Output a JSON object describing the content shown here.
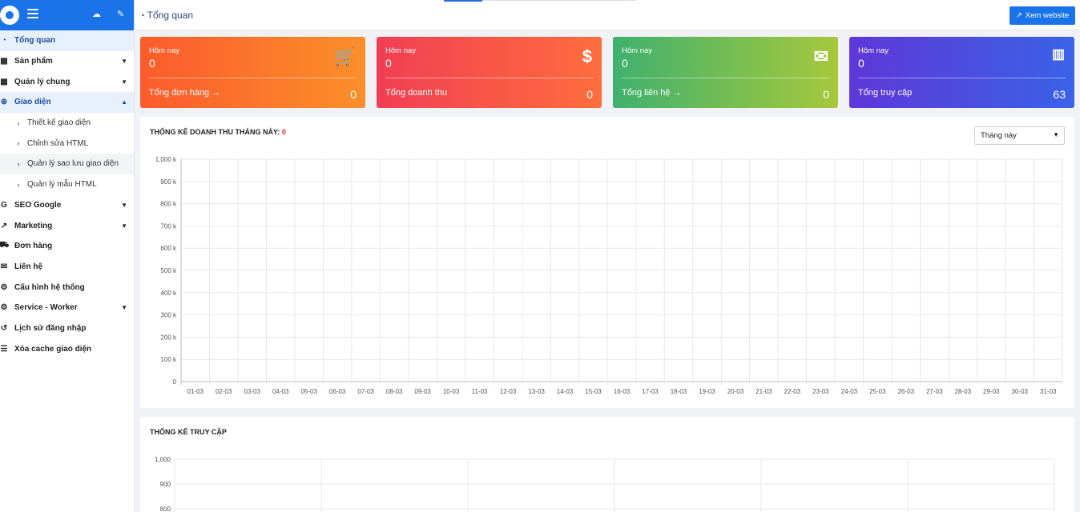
{
  "header": {
    "title": "Tổng quan",
    "view_site_label": "Xem website"
  },
  "sidebar": {
    "items": [
      {
        "label": "Tổng quan",
        "icon": "dashboard-icon"
      },
      {
        "label": "Sản phẩm",
        "icon": "grid-icon"
      },
      {
        "label": "Quản lý chung",
        "icon": "grid-icon"
      },
      {
        "label": "Giao diện",
        "icon": "globe-icon"
      },
      {
        "label": "Thiết kế giao diện"
      },
      {
        "label": "Chỉnh sửa HTML"
      },
      {
        "label": "Quản lý sao lưu giao diện"
      },
      {
        "label": "Quản lý mẫu HTML"
      },
      {
        "label": "SEO Google",
        "icon": "google-icon"
      },
      {
        "label": "Marketing",
        "icon": "chart-icon"
      },
      {
        "label": "Đơn hàng",
        "icon": "cart-icon"
      },
      {
        "label": "Liên hệ",
        "icon": "envelope-icon"
      },
      {
        "label": "Cấu hình hệ thống",
        "icon": "gear-icon"
      },
      {
        "label": "Service - Worker",
        "icon": "gears-icon"
      },
      {
        "label": "Lịch sử đăng nhập",
        "icon": "history-icon"
      },
      {
        "label": "Xóa cache giao diện",
        "icon": "database-icon"
      }
    ]
  },
  "cards": [
    {
      "top_label": "Hôm nay",
      "top_value": "0",
      "bottom_label": "Tổng đơn hàng →",
      "bottom_value": "0",
      "icon": "cart-icon"
    },
    {
      "top_label": "Hôm nay",
      "top_value": "0",
      "bottom_label": "Tổng doanh thu",
      "bottom_value": "0",
      "icon": "dollar-icon"
    },
    {
      "top_label": "Hôm nay",
      "top_value": "0",
      "bottom_label": "Tổng liên hệ →",
      "bottom_value": "0",
      "icon": "envelope-icon"
    },
    {
      "top_label": "Hôm nay",
      "top_value": "0",
      "bottom_label": "Tổng truy cập",
      "bottom_value": "63",
      "icon": "bar-chart-icon"
    }
  ],
  "revenue": {
    "title": "THỐNG KÊ DOANH THU THÁNG NÀY:",
    "total": "0",
    "period_select": "Tháng này"
  },
  "visits": {
    "title": "THỐNG KÊ TRUY CẬP"
  },
  "chart_data": [
    {
      "type": "bar",
      "title": "THỐNG KÊ DOANH THU THÁNG NÀY: 0",
      "categories": [
        "01-03",
        "02-03",
        "03-03",
        "04-03",
        "05-03",
        "06-03",
        "07-03",
        "08-03",
        "09-03",
        "10-03",
        "11-03",
        "12-03",
        "13-03",
        "14-03",
        "15-03",
        "16-03",
        "17-03",
        "18-03",
        "19-03",
        "20-03",
        "21-03",
        "22-03",
        "23-03",
        "24-03",
        "25-03",
        "26-03",
        "27-03",
        "28-03",
        "29-03",
        "30-03",
        "31-03"
      ],
      "values": [
        0,
        0,
        0,
        0,
        0,
        0,
        0,
        0,
        0,
        0,
        0,
        0,
        0,
        0,
        0,
        0,
        0,
        0,
        0,
        0,
        0,
        0,
        0,
        0,
        0,
        0,
        0,
        0,
        0,
        0,
        0
      ],
      "ytick_labels": [
        "0",
        "100 k",
        "200 k",
        "300 k",
        "400 k",
        "500 k",
        "600 k",
        "700 k",
        "800 k",
        "900 k",
        "1,000 k"
      ],
      "ylim": [
        0,
        1000000
      ],
      "grid": true
    },
    {
      "type": "line",
      "title": "THỐNG KÊ TRUY CẬP",
      "ytick_labels": [
        "800",
        "900",
        "1,000"
      ],
      "ylim_visible": [
        800,
        1000
      ],
      "grid": true
    }
  ]
}
